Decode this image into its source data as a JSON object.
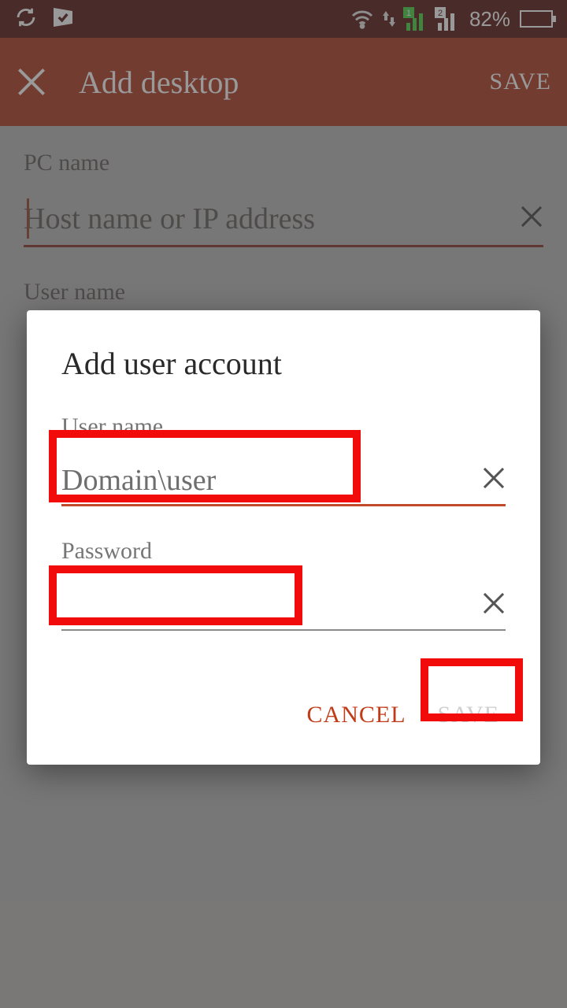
{
  "status": {
    "battery_percent": "82%"
  },
  "appbar": {
    "title": "Add desktop",
    "save_label": "SAVE"
  },
  "page": {
    "pc_name_label": "PC name",
    "pc_name_placeholder": "Host name or IP address",
    "user_name_label": "User name"
  },
  "dialog": {
    "title": "Add user account",
    "username_label": "User name",
    "username_placeholder": "Domain\\user",
    "password_label": "Password",
    "password_value": "",
    "cancel_label": "CANCEL",
    "save_label": "SAVE"
  }
}
